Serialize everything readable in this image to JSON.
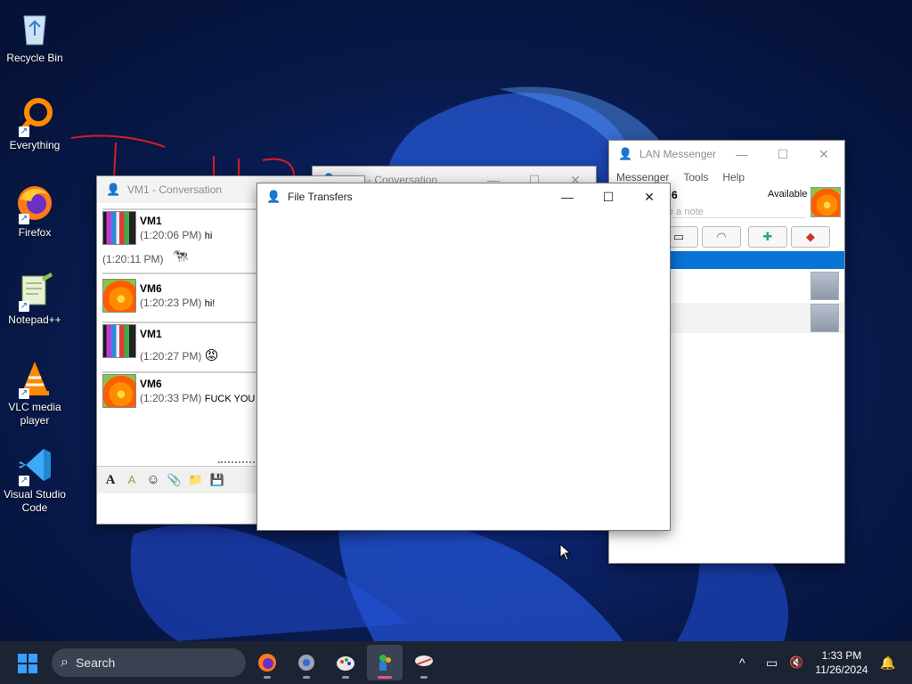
{
  "desktop": {
    "icons": [
      {
        "label": "Recycle Bin",
        "icon": "recycle-bin-icon"
      },
      {
        "label": "Everything",
        "icon": "everything-search-icon"
      },
      {
        "label": "Firefox",
        "icon": "firefox-icon"
      },
      {
        "label": "Notepad++",
        "icon": "notepad-plus-plus-icon"
      },
      {
        "label": "VLC media player",
        "icon": "vlc-icon"
      },
      {
        "label": "Visual Studio Code",
        "icon": "vscode-icon"
      }
    ]
  },
  "conversation_vm1": {
    "title": "VM1 - Conversation",
    "messages": [
      {
        "sender": "VM1",
        "time": "(1:20:06 PM)",
        "text": "hi"
      },
      {
        "sender": "",
        "time": "(1:20:11 PM)",
        "text": "🐄"
      },
      {
        "sender": "VM6",
        "time": "(1:20:23 PM)",
        "text": "hi!"
      },
      {
        "sender": "VM1",
        "time": "(1:20:27 PM)",
        "text": "😡"
      },
      {
        "sender": "VM6",
        "time": "(1:20:33 PM)",
        "text": "FUCK YOU"
      }
    ]
  },
  "conversation_vm5": {
    "title": "VM5 - Conversation"
  },
  "lan_messenger": {
    "title": "LAN Messenger",
    "menu": [
      "Messenger",
      "Tools",
      "Help"
    ],
    "username_fragment": "6",
    "status": "Available",
    "note_placeholder": "e a note"
  },
  "file_transfers": {
    "title": "File Transfers"
  },
  "taskbar": {
    "search_label": "Search",
    "clock_time": "1:33 PM",
    "clock_date": "11/26/2024"
  },
  "colors": {
    "accent": "#0a73d6",
    "taskbar": "#1c2333",
    "active_indicator": "#e05a7a"
  }
}
